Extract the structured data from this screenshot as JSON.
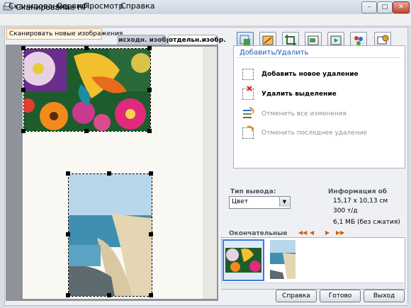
{
  "window": {
    "title": "Сканирование HP"
  },
  "menu": [
    "Сканирование",
    "Сервис",
    "Просмотр",
    "Справка"
  ],
  "scan_new_label": "Сканировать новые изображения",
  "view_tabs": [
    {
      "label": "исходн. изобр.",
      "active": false
    },
    {
      "label": "отдельн.изобр.",
      "active": true
    }
  ],
  "toolbar_icons": [
    "add-remove-icon",
    "color-adjust-icon",
    "crop-icon",
    "resize-icon",
    "output-icon",
    "color-icon",
    "settings-icon"
  ],
  "panel": {
    "title": "Добавить/Удалить",
    "actions": [
      {
        "label": "Добавить новое удаление",
        "enabled": true
      },
      {
        "label": "Удалить выделение",
        "enabled": true
      },
      {
        "label": "Отменить все изменения",
        "enabled": false
      },
      {
        "label": "Отменить последнее удаление",
        "enabled": false
      }
    ]
  },
  "output": {
    "label": "Тип вывода:",
    "value": "Цвет"
  },
  "info": {
    "label": "Информация об",
    "size": "15,17 x 10,13 см",
    "dpi": "300 т/д",
    "filesize": "6,1 МБ (без сжатия)"
  },
  "finals": {
    "label": "Окончательные"
  },
  "buttons": {
    "help": "Справка",
    "done": "Готово",
    "exit": "Выход"
  },
  "colors": {
    "accent": "#1f57b5",
    "nav_arrow": "#d25b0c",
    "selection_blue": "#3d7ad9"
  }
}
